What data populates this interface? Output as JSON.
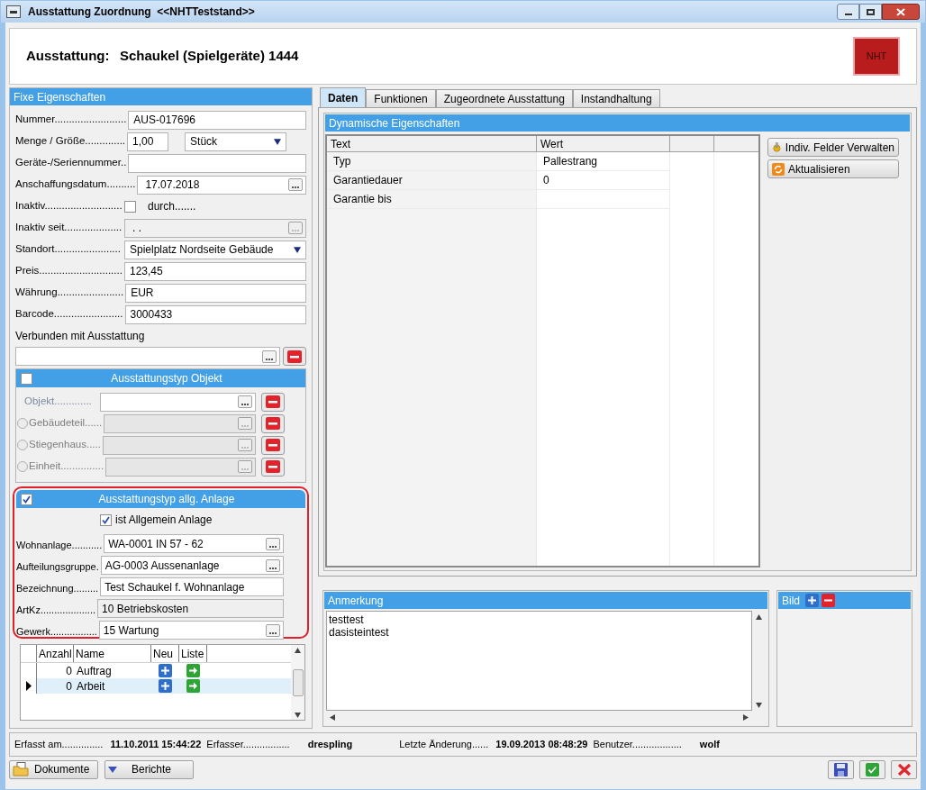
{
  "window": {
    "title": "Ausstattung Zuordnung  <<NHTTeststand>>"
  },
  "header": {
    "label": "Ausstattung:",
    "value": "Schaukel (Spielgeräte) 1444",
    "logo": "NHT"
  },
  "fixed": {
    "title": "Fixe Eigenschaften",
    "fields": [
      {
        "kind": "text",
        "label": "Nummer.........................",
        "value": "AUS-017696"
      },
      {
        "kind": "quantity",
        "label": "Menge / Größe..............",
        "value": "1,00",
        "unit": "Stück"
      },
      {
        "kind": "text",
        "label": "Geräte-/Seriennummer.."
      },
      {
        "kind": "picker",
        "label": "Anschaffungsdatum..........",
        "value": "17.07.2018",
        "disabled": false
      },
      {
        "kind": "checkbox",
        "label": "Inaktiv...........................",
        "checked": false,
        "extra": "durch......."
      },
      {
        "kind": "picker",
        "label": "Inaktiv seit....................",
        "value": ".  .",
        "disabled": true
      },
      {
        "kind": "select",
        "label": "Standort.......................",
        "value": "Spielplatz Nordseite Gebäude"
      },
      {
        "kind": "text",
        "label": "Preis.............................",
        "value": "123,45"
      },
      {
        "kind": "text",
        "label": "Währung.......................",
        "value": "EUR"
      },
      {
        "kind": "text",
        "label": "Barcode........................",
        "value": "3000433"
      }
    ],
    "linked_label": "Verbunden mit Ausstattung"
  },
  "objekt_group": {
    "title": "Ausstattungstyp Objekt",
    "checked": false,
    "rows": [
      {
        "kind": "plain",
        "label": "Objekt.............",
        "disabled": false
      },
      {
        "kind": "radio",
        "label": "Gebäudeteil......",
        "selected": false,
        "disabled": true
      },
      {
        "kind": "radio",
        "label": "Stiegenhaus.....",
        "selected": false,
        "disabled": true
      },
      {
        "kind": "radio",
        "label": "Einheit...............",
        "selected": false,
        "disabled": true
      }
    ]
  },
  "anlage_group": {
    "title": "Ausstattungstyp allg. Anlage",
    "checked": true,
    "highlighted": true,
    "option": {
      "label": "ist Allgemein Anlage",
      "checked": true
    },
    "fields": [
      {
        "label": "Wohnanlage...........",
        "value": "WA-0001 IN 57 - 62",
        "picker": true,
        "disabled": false
      },
      {
        "label": "Aufteilungsgruppe.",
        "value": "AG-0003 Aussenanlage",
        "picker": true,
        "disabled": false
      },
      {
        "label": "Bezeichnung.........",
        "value": "Test Schaukel f. Wohnanlage",
        "picker": false,
        "disabled": false
      },
      {
        "label": "ArtKz....................",
        "value": "10 Betriebskosten",
        "picker": false,
        "disabled": true
      },
      {
        "label": "Gewerk.................",
        "value": "15 Wartung",
        "picker": true,
        "disabled": false
      }
    ]
  },
  "grid": {
    "columns": [
      "Anzahl",
      "Name",
      "Neu",
      "Liste"
    ],
    "rows": [
      {
        "count": "0",
        "name": "Auftrag",
        "selected": false
      },
      {
        "count": "0",
        "name": "Arbeit",
        "selected": true
      }
    ]
  },
  "tabs": [
    {
      "label": "Daten",
      "selected": true
    },
    {
      "label": "Funktionen",
      "selected": false
    },
    {
      "label": "Zugeordnete Ausstattung",
      "selected": false
    },
    {
      "label": "Instandhaltung",
      "selected": false
    }
  ],
  "dynamic": {
    "title": "Dynamische Eigenschaften",
    "columns": [
      "Text",
      "Wert"
    ],
    "rows": [
      {
        "text": "Typ",
        "value": "Pallestrang"
      },
      {
        "text": "Garantiedauer",
        "value": "0"
      },
      {
        "text": "Garantie bis"
      }
    ],
    "buttons": [
      {
        "kind": "manage",
        "label": "Indiv. Felder Verwalten"
      },
      {
        "kind": "refresh",
        "label": "Aktualisieren"
      }
    ]
  },
  "anmerkung": {
    "title": "Anmerkung",
    "lines": [
      "testtest",
      "dasisteintest"
    ]
  },
  "bild": {
    "title": "Bild"
  },
  "status_bar": [
    {
      "label": "Erfasst am...............",
      "value": "11.10.2011 15:44:22"
    },
    {
      "label": "Erfasser.................",
      "value": "drespling"
    },
    {
      "label": "Letzte Änderung......",
      "value": "19.09.2013 08:48:29"
    },
    {
      "label": "Benutzer..................",
      "value": "wolf"
    }
  ],
  "footer_buttons": [
    {
      "kind": "documents",
      "label": "Dokumente"
    },
    {
      "kind": "reports",
      "label": "Berichte"
    }
  ]
}
